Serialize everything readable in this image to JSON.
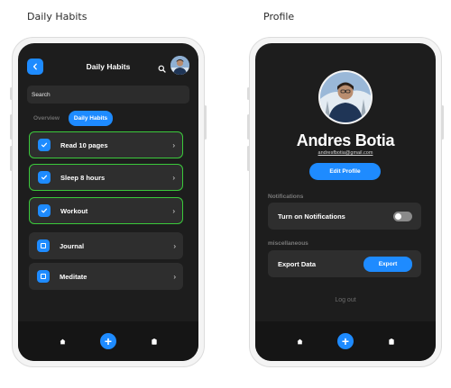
{
  "frames": {
    "left_label": "Daily Habits",
    "right_label": "Profile"
  },
  "habits_screen": {
    "title": "Daily Habits",
    "search_placeholder": "Search",
    "tabs": [
      {
        "label": "Overview",
        "active": false
      },
      {
        "label": "Daily Habits",
        "active": true
      }
    ],
    "habits": [
      {
        "label": "Read 10 pages",
        "completed": true,
        "icon": "check-icon"
      },
      {
        "label": "Sleep 8 hours",
        "completed": true,
        "icon": "check-icon"
      },
      {
        "label": "Workout",
        "completed": true,
        "icon": "check-icon"
      },
      {
        "label": "Journal",
        "completed": false,
        "icon": "square-icon"
      },
      {
        "label": "Meditate",
        "completed": false,
        "icon": "square-icon"
      }
    ],
    "chevron": "›"
  },
  "profile_screen": {
    "name": "Andres Botia",
    "email": "andresfbotia@gmail.com",
    "edit_label": "Edit Profile",
    "notifications_section": "Notifications",
    "notifications_label": "Turn on Notifications",
    "notifications_on": false,
    "misc_section": "miscellaneous",
    "export_label": "Export Data",
    "export_button": "Export",
    "logout_label": "Log out"
  },
  "bottom_nav": {
    "items": [
      "home-icon",
      "add-icon",
      "clipboard-icon"
    ],
    "add_symbol": "+"
  },
  "colors": {
    "accent": "#1e8bff",
    "success_border": "#3bc93b",
    "screen_bg": "#1d1d1d",
    "card_bg": "#2e2e2e"
  }
}
